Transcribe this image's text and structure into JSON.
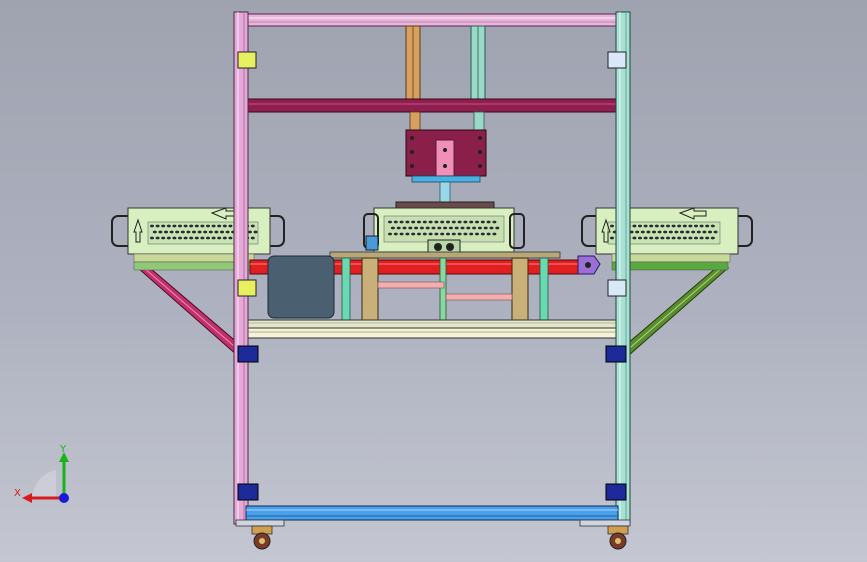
{
  "triad": {
    "x_label": "X",
    "y_label": "Y",
    "x_color": "#d81c1c",
    "y_color": "#19b419",
    "z_color": "#1a1ad8"
  },
  "colors": {
    "background": "#a9adbb",
    "frame_left": "#e6a8d8",
    "frame_right": "#a8e0d4",
    "top_beam": "#e8b4dc",
    "cross_beam": "#8f1f4f",
    "bottom_beam": "#4aa0e8",
    "platform": "#e8e6c0",
    "conveyor_red": "#e02020",
    "machine_body": "#d8efc0",
    "press_plate": "#8a1f4a",
    "corner_bracket": "#1d2a9a",
    "side_brace_left": "#c0306a",
    "side_brace_right": "#5c8c30",
    "dark_box": "#4a5f70"
  }
}
